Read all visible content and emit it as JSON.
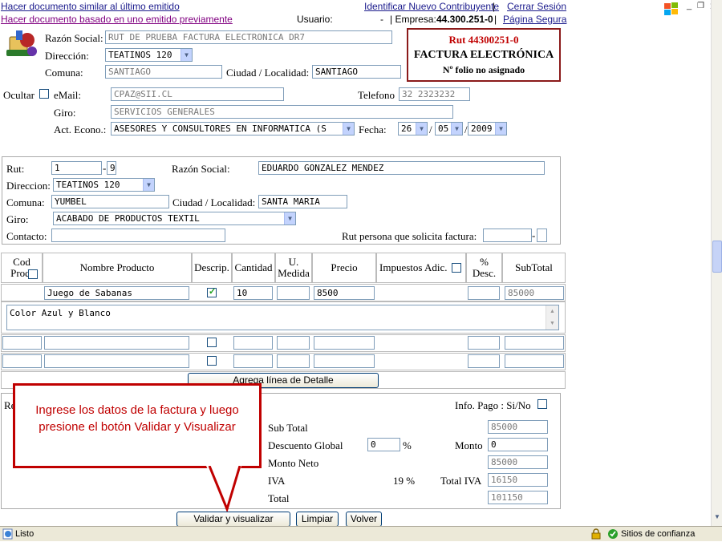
{
  "top": {
    "link_similar": "Hacer documento similar al último emitido",
    "link_based": "Hacer documento basado en uno emitido previamente",
    "usuario_label": "Usuario:",
    "usuario_value": "-",
    "empresa_label": "| Empresa:",
    "empresa_value": "44.300.251-0",
    "link_identify": "Identificar Nuevo Contribuyente",
    "link_logout": "Cerrar Sesión",
    "link_secure": "Página Segura",
    "sep": "|"
  },
  "header_box": {
    "rut": "Rut 44300251-0",
    "doc_type": "FACTURA ELECTRÓNICA",
    "folio": "Nº folio no asignado"
  },
  "emisor": {
    "razon_label": "Razón Social:",
    "razon_value": "RUT DE PRUEBA FACTURA ELECTRONICA DR7",
    "direccion_label": "Dirección:",
    "direccion_value": "TEATINOS 120",
    "comuna_label": "Comuna:",
    "comuna_value": "SANTIAGO",
    "ciudad_label": "Ciudad / Localidad:",
    "ciudad_value": "SANTIAGO",
    "ocultar_label": "Ocultar",
    "email_label": "eMail:",
    "email_value": "CPAZ@SII.CL",
    "telefono_label": "Telefono",
    "telefono_value": "32 2323232",
    "giro_label": "Giro:",
    "giro_value": "SERVICIOS GENERALES",
    "acteco_label": "Act. Econo.:",
    "acteco_value": "ASESORES Y CONSULTORES EN INFORMATICA (S",
    "fecha_label": "Fecha:",
    "fecha_day": "26",
    "fecha_month": "05",
    "fecha_year": "2009",
    "fecha_sep": "/"
  },
  "receptor": {
    "rut_label": "Rut:",
    "rut_value": "1",
    "rut_dv": "9",
    "dash": "-",
    "razon_label": "Razón Social:",
    "razon_value": "EDUARDO GONZALEZ MENDEZ",
    "direccion_label": "Direccion:",
    "direccion_value": "TEATINOS 120",
    "comuna_label": "Comuna:",
    "comuna_value": "YUMBEL",
    "ciudad_label": "Ciudad / Localidad:",
    "ciudad_value": "SANTA MARIA",
    "giro_label": "Giro:",
    "giro_value": "ACABADO DE PRODUCTOS TEXTIL",
    "contacto_label": "Contacto:",
    "contacto_value": "",
    "rut_solicita_label": "Rut persona que solicita factura:"
  },
  "detalle": {
    "headers": {
      "cod": "Cod Prod.",
      "nombre": "Nombre Producto",
      "descrip": "Descrip.",
      "cantidad": "Cantidad",
      "umedida": "U. Medida",
      "precio": "Precio",
      "impuestos": "Impuestos Adic.",
      "desc": "% Desc.",
      "subtotal": "SubTotal"
    },
    "row1": {
      "nombre": "Juego de Sabanas",
      "cantidad": "10",
      "precio": "8500",
      "subtotal": "85000",
      "descripcion": "Color Azul y Blanco"
    },
    "add_button": "Agrega línea de Detalle"
  },
  "totales": {
    "referencias_label": "Re",
    "info_pago_label": "Info. Pago : Si/No",
    "subtotal_label": "Sub Total",
    "subtotal_value": "85000",
    "descuento_label": "Descuento Global",
    "descuento_value": "0",
    "pct": "%",
    "monto_label": "Monto",
    "monto_value": "0",
    "neto_label": "Monto Neto",
    "neto_value": "85000",
    "iva_label": "IVA",
    "iva_pct": "19 %",
    "total_iva_label": "Total IVA",
    "total_iva_value": "16150",
    "total_label": "Total",
    "total_value": "101150"
  },
  "callout": {
    "text": "Ingrese los datos de la factura y luego presione el botón Validar y Visualizar",
    "color": "#c00000"
  },
  "buttons": {
    "validar": "Validar y visualizar",
    "limpiar": "Limpiar",
    "volver": "Volver"
  },
  "status": {
    "text": "Listo",
    "zone": "Sitios de confianza"
  },
  "colors": {
    "box_border": "#8b1a1a",
    "rut_red": "#c00000",
    "link_blue": "#1a1a8c"
  },
  "icons": [
    "windows-logo-icon",
    "minimize-icon",
    "restore-icon",
    "close-icon",
    "company-logo-icon",
    "checkbox-icon",
    "dropdown-arrow-icon",
    "ie-page-icon",
    "lock-icon",
    "trusted-sites-icon"
  ]
}
